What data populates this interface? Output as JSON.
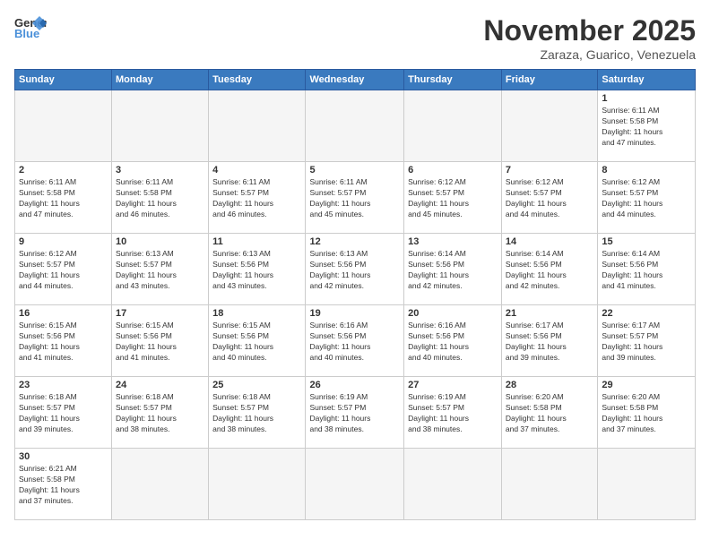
{
  "logo": {
    "general": "General",
    "blue": "Blue"
  },
  "title": "November 2025",
  "subtitle": "Zaraza, Guarico, Venezuela",
  "days_header": [
    "Sunday",
    "Monday",
    "Tuesday",
    "Wednesday",
    "Thursday",
    "Friday",
    "Saturday"
  ],
  "weeks": [
    [
      {
        "day": "",
        "info": ""
      },
      {
        "day": "",
        "info": ""
      },
      {
        "day": "",
        "info": ""
      },
      {
        "day": "",
        "info": ""
      },
      {
        "day": "",
        "info": ""
      },
      {
        "day": "",
        "info": ""
      },
      {
        "day": "1",
        "info": "Sunrise: 6:11 AM\nSunset: 5:58 PM\nDaylight: 11 hours\nand 47 minutes."
      }
    ],
    [
      {
        "day": "2",
        "info": "Sunrise: 6:11 AM\nSunset: 5:58 PM\nDaylight: 11 hours\nand 47 minutes."
      },
      {
        "day": "3",
        "info": "Sunrise: 6:11 AM\nSunset: 5:58 PM\nDaylight: 11 hours\nand 46 minutes."
      },
      {
        "day": "4",
        "info": "Sunrise: 6:11 AM\nSunset: 5:57 PM\nDaylight: 11 hours\nand 46 minutes."
      },
      {
        "day": "5",
        "info": "Sunrise: 6:11 AM\nSunset: 5:57 PM\nDaylight: 11 hours\nand 45 minutes."
      },
      {
        "day": "6",
        "info": "Sunrise: 6:12 AM\nSunset: 5:57 PM\nDaylight: 11 hours\nand 45 minutes."
      },
      {
        "day": "7",
        "info": "Sunrise: 6:12 AM\nSunset: 5:57 PM\nDaylight: 11 hours\nand 44 minutes."
      },
      {
        "day": "8",
        "info": "Sunrise: 6:12 AM\nSunset: 5:57 PM\nDaylight: 11 hours\nand 44 minutes."
      }
    ],
    [
      {
        "day": "9",
        "info": "Sunrise: 6:12 AM\nSunset: 5:57 PM\nDaylight: 11 hours\nand 44 minutes."
      },
      {
        "day": "10",
        "info": "Sunrise: 6:13 AM\nSunset: 5:57 PM\nDaylight: 11 hours\nand 43 minutes."
      },
      {
        "day": "11",
        "info": "Sunrise: 6:13 AM\nSunset: 5:56 PM\nDaylight: 11 hours\nand 43 minutes."
      },
      {
        "day": "12",
        "info": "Sunrise: 6:13 AM\nSunset: 5:56 PM\nDaylight: 11 hours\nand 42 minutes."
      },
      {
        "day": "13",
        "info": "Sunrise: 6:14 AM\nSunset: 5:56 PM\nDaylight: 11 hours\nand 42 minutes."
      },
      {
        "day": "14",
        "info": "Sunrise: 6:14 AM\nSunset: 5:56 PM\nDaylight: 11 hours\nand 42 minutes."
      },
      {
        "day": "15",
        "info": "Sunrise: 6:14 AM\nSunset: 5:56 PM\nDaylight: 11 hours\nand 41 minutes."
      }
    ],
    [
      {
        "day": "16",
        "info": "Sunrise: 6:15 AM\nSunset: 5:56 PM\nDaylight: 11 hours\nand 41 minutes."
      },
      {
        "day": "17",
        "info": "Sunrise: 6:15 AM\nSunset: 5:56 PM\nDaylight: 11 hours\nand 41 minutes."
      },
      {
        "day": "18",
        "info": "Sunrise: 6:15 AM\nSunset: 5:56 PM\nDaylight: 11 hours\nand 40 minutes."
      },
      {
        "day": "19",
        "info": "Sunrise: 6:16 AM\nSunset: 5:56 PM\nDaylight: 11 hours\nand 40 minutes."
      },
      {
        "day": "20",
        "info": "Sunrise: 6:16 AM\nSunset: 5:56 PM\nDaylight: 11 hours\nand 40 minutes."
      },
      {
        "day": "21",
        "info": "Sunrise: 6:17 AM\nSunset: 5:56 PM\nDaylight: 11 hours\nand 39 minutes."
      },
      {
        "day": "22",
        "info": "Sunrise: 6:17 AM\nSunset: 5:57 PM\nDaylight: 11 hours\nand 39 minutes."
      }
    ],
    [
      {
        "day": "23",
        "info": "Sunrise: 6:18 AM\nSunset: 5:57 PM\nDaylight: 11 hours\nand 39 minutes."
      },
      {
        "day": "24",
        "info": "Sunrise: 6:18 AM\nSunset: 5:57 PM\nDaylight: 11 hours\nand 38 minutes."
      },
      {
        "day": "25",
        "info": "Sunrise: 6:18 AM\nSunset: 5:57 PM\nDaylight: 11 hours\nand 38 minutes."
      },
      {
        "day": "26",
        "info": "Sunrise: 6:19 AM\nSunset: 5:57 PM\nDaylight: 11 hours\nand 38 minutes."
      },
      {
        "day": "27",
        "info": "Sunrise: 6:19 AM\nSunset: 5:57 PM\nDaylight: 11 hours\nand 38 minutes."
      },
      {
        "day": "28",
        "info": "Sunrise: 6:20 AM\nSunset: 5:58 PM\nDaylight: 11 hours\nand 37 minutes."
      },
      {
        "day": "29",
        "info": "Sunrise: 6:20 AM\nSunset: 5:58 PM\nDaylight: 11 hours\nand 37 minutes."
      }
    ],
    [
      {
        "day": "30",
        "info": "Sunrise: 6:21 AM\nSunset: 5:58 PM\nDaylight: 11 hours\nand 37 minutes."
      },
      {
        "day": "",
        "info": ""
      },
      {
        "day": "",
        "info": ""
      },
      {
        "day": "",
        "info": ""
      },
      {
        "day": "",
        "info": ""
      },
      {
        "day": "",
        "info": ""
      },
      {
        "day": "",
        "info": ""
      }
    ]
  ]
}
